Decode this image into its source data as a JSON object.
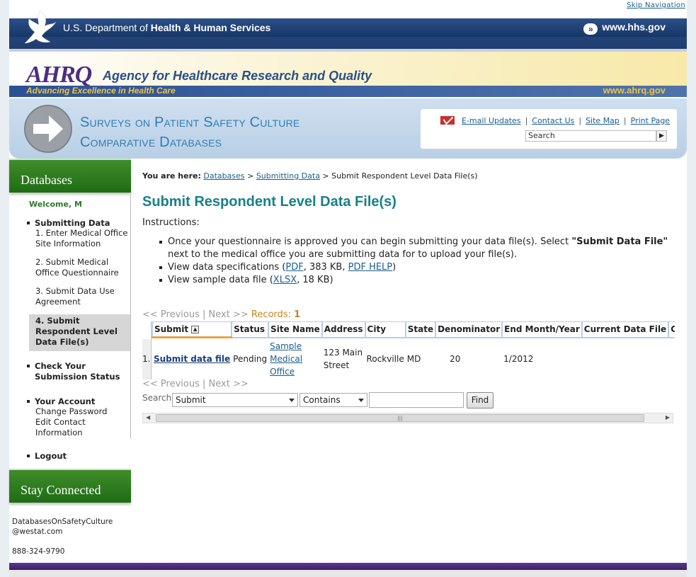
{
  "skip_nav": "Skip Navigation",
  "hhs": {
    "title_plain": "U.S. Department of ",
    "title_bold": "Health & Human Services",
    "url": "www.hhs.gov"
  },
  "ahrq": {
    "logo": "AHRQ",
    "name": "Agency for Healthcare Research and Quality",
    "tagline": "Advancing Excellence in Health Care",
    "url": "www.ahrq.gov"
  },
  "banner": {
    "line1": "Surveys on Patient Safety Culture",
    "line2": "Comparative Databases"
  },
  "util": {
    "email": "E-mail Updates",
    "contact": "Contact Us",
    "sitemap": "Site Map",
    "print": "Print Page",
    "search_value": "Search"
  },
  "sidebar": {
    "heading": "Databases",
    "welcome": "Welcome, M",
    "submitting": "Submitting Data",
    "steps": [
      "1. Enter Medical Office Site Information",
      "2. Submit Medical Office Questionnaire",
      "3. Submit Data Use Agreement",
      "4. Submit Respondent Level Data File(s)"
    ],
    "check": "Check Your Submission Status",
    "account": "Your Account",
    "change_password": "Change Password",
    "edit_contact": "Edit Contact Information",
    "logout": "Logout",
    "stay": "Stay Connected",
    "email": "DatabasesOnSafetyCulture @westat.com",
    "phone": "888-324-9790"
  },
  "main": {
    "crumb_label": "You are here:",
    "crumb": [
      "Databases",
      "Submitting Data",
      "Submit Respondent Level Data File(s)"
    ],
    "title": "Submit Respondent Level Data File(s)",
    "instructions_label": "Instructions:",
    "bullet1_a": "Once your questionnaire is approved you can begin submitting your data file(s). Select ",
    "bullet1_b": "\"Submit Data File\"",
    "bullet1_c": " next to the medical office you are submitting data for to upload your file(s).",
    "bullet2_a": "View data specifications (",
    "bullet2_pdf": "PDF",
    "bullet2_b": ", 383 KB, ",
    "bullet2_help": "PDF HELP",
    "bullet2_c": ")",
    "bullet3_a": "View sample data file (",
    "bullet3_xlsx": "XLSX",
    "bullet3_b": ", 18 KB)"
  },
  "pager": {
    "prev": "<< Previous",
    "sep": "|",
    "next": "Next >>",
    "records_label": "Records:",
    "records": "1"
  },
  "table": {
    "headers": [
      "Submit",
      "Status",
      "Site Name",
      "Address",
      "City",
      "State",
      "Denominator",
      "End Month/Year",
      "Current Data File",
      "Current Data File Stat"
    ],
    "row": {
      "num": "1.",
      "submit": "Submit data file",
      "status": "Pending",
      "site_name": "Sample Medical Office",
      "address": "123 Main Street",
      "city": "Rockville",
      "state": "MD",
      "denominator": "20",
      "end": "1/2012",
      "file": "",
      "file_status": ""
    }
  },
  "search": {
    "label": "Search:",
    "field": "Submit",
    "operator": "Contains",
    "value": "",
    "button": "Find"
  }
}
